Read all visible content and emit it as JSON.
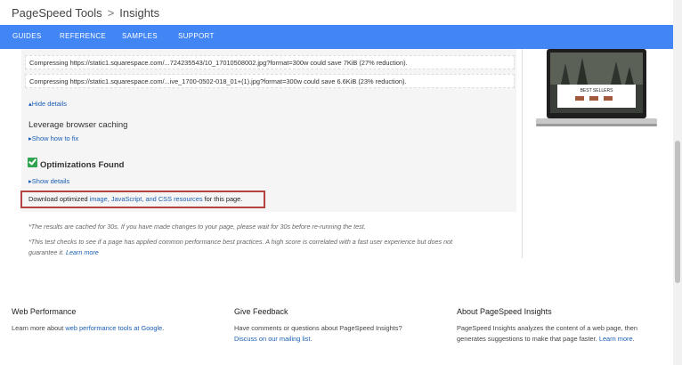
{
  "breadcrumb": {
    "parent": "PageSpeed Tools",
    "separator": ">",
    "current": "Insights"
  },
  "nav": [
    "GUIDES",
    "REFERENCE",
    "SAMPLES",
    "SUPPORT"
  ],
  "report": {
    "rows": [
      "Compressing https://static1.squarespace.com/...724235543/10_17010508002.jpg?format=300w could save 7KiB (27% reduction).",
      "Compressing https://static1.squarespace.com/...ive_1700-0502-018_01+(1).jpg?format=300w could save 6.6KiB (23% reduction)."
    ],
    "hide_details": "Hide details",
    "caching_heading": "Leverage browser caching",
    "show_fix": "Show how to fix",
    "optimizations_heading": "Optimizations Found",
    "show_details": "Show details",
    "download_prefix": "Download optimized ",
    "download_link": "image, JavaScript, and CSS resources",
    "download_suffix": " for this page."
  },
  "notes": {
    "cached": "*The results are cached for 30s. If you have made changes to your page, please wait for 30s before re-running the test.",
    "checks_line1": "*This test checks to see if a page has applied common performance best practices. A high score is correlated with a fast user experience but does not",
    "checks_line2": "guarantee it. ",
    "learn_more": "Learn more"
  },
  "preview": {
    "banner_text": "BEST SELLERS"
  },
  "footer": {
    "web_performance": {
      "title": "Web Performance",
      "text": "Learn more about ",
      "link": "web performance tools at Google",
      "end": "."
    },
    "feedback": {
      "title": "Give Feedback",
      "text": "Have comments or questions about PageSpeed Insights?",
      "link": "Discuss on our mailing list",
      "end": "."
    },
    "about": {
      "title": "About PageSpeed Insights",
      "line1": "PageSpeed Insights analyzes the content of a web page, then",
      "line2": "generates suggestions to make that page faster. ",
      "link": "Learn more",
      "end": "."
    }
  },
  "colors": {
    "nav": "#4285f4",
    "link": "#1a5fb4",
    "check": "#2fa44f",
    "highlight_border": "#b5433f"
  }
}
